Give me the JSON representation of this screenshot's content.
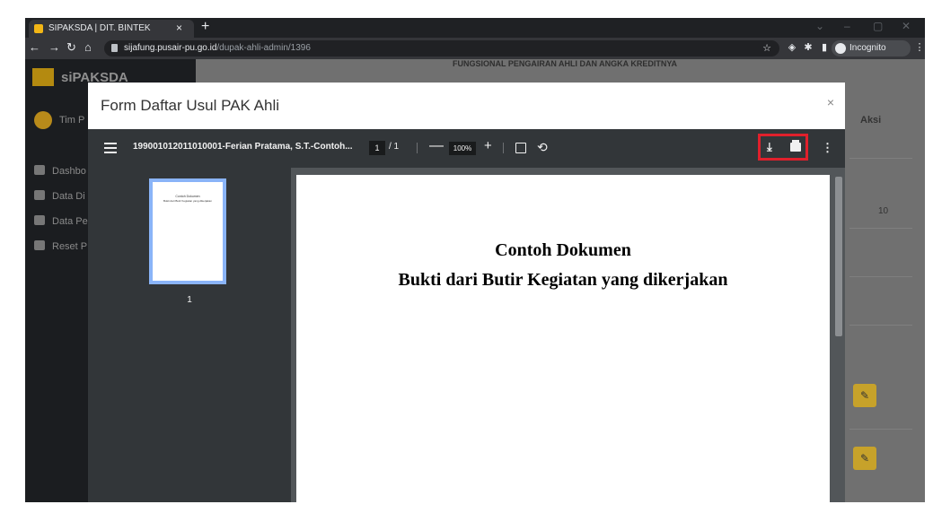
{
  "browser": {
    "tab_title": "SIPAKSDA | DIT. BINTEK",
    "tab_close": "×",
    "new_tab": "+",
    "url_host": "sijafung.pusair-pu.go.id",
    "url_path": "/dupak-ahli-admin/1396",
    "incognito_label": "Incognito",
    "window_controls": [
      "⌄",
      "–",
      "▢",
      "✕"
    ]
  },
  "app": {
    "brand": "siPAKSDA",
    "user_name": "Tim P",
    "sidebar_items": [
      "Dashbo",
      "Data Di",
      "Data Pe",
      "Reset P"
    ],
    "content_header": "FUNGSIONAL PENGAIRAN AHLI DAN ANGKA KREDITNYA",
    "aksi_header": "Aksi",
    "aksi_value": "10",
    "colors": {
      "sidebar": "#1b1d20",
      "edit_button": "#c7a22a"
    }
  },
  "modal": {
    "title": "Form Daftar Usul PAK Ahli",
    "close": "×"
  },
  "pdf": {
    "doc_title": "199001012011010001-Ferian Pratama, S.T.-Contoh...",
    "page_current": "1",
    "page_total": "/ 1",
    "zoom_out": "—",
    "zoom": "100%",
    "zoom_in": "+",
    "rotate": "⟲",
    "download": "⤓",
    "more": "⋮",
    "thumbnail_page": "1",
    "page_heading": "Contoh Dokumen",
    "page_subheading": "Bukti dari Butir Kegiatan yang dikerjakan",
    "highlight_color": "#e0202c"
  }
}
